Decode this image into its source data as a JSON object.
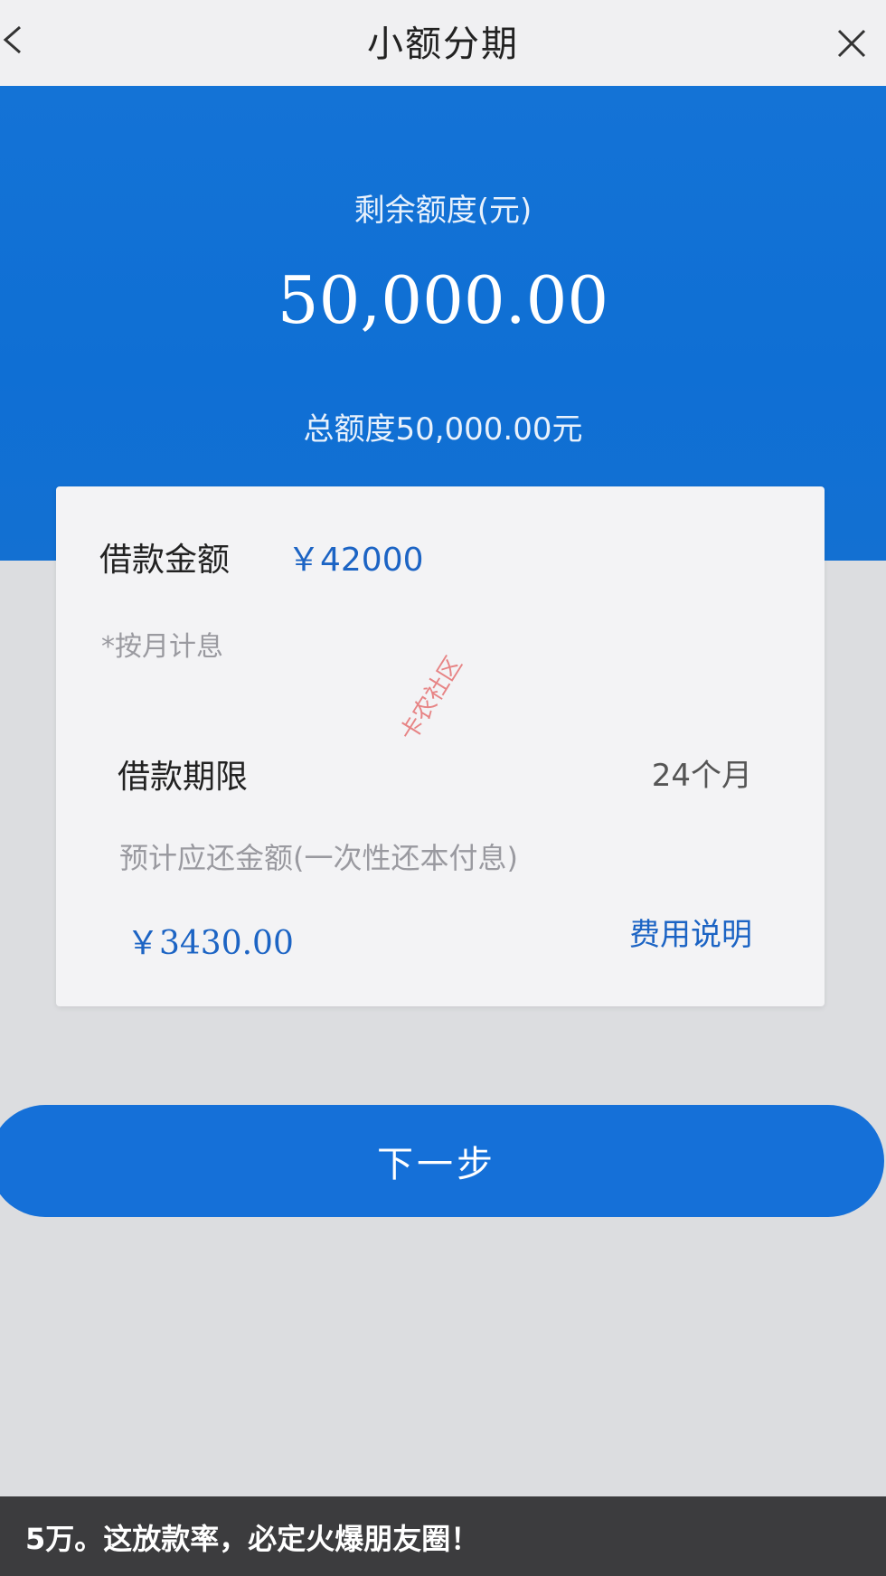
{
  "header": {
    "title": "小额分期",
    "back_icon": "chevron-left-icon",
    "close_icon": "close-icon"
  },
  "hero": {
    "label": "剩余额度(元)",
    "remaining_amount": "50,000.00",
    "total_text": "总额度50,000.00元"
  },
  "loan_card": {
    "amount_label": "借款金额",
    "amount_value": "￥42000",
    "interest_note": "*按月计息",
    "term_label": "借款期限",
    "term_value": "24个月",
    "repay_label": "预计应还金额(一次性还本付息)",
    "repay_amount": "￥3430.00",
    "fee_link": "费用说明"
  },
  "watermark": "卡农社区",
  "next_button": "下一步",
  "caption": "5万。这放款率，必定火爆朋友圈！",
  "colors": {
    "primary_blue": "#1570d8",
    "link_blue": "#1c64c4",
    "caption_bg": "#3c3c3e"
  }
}
